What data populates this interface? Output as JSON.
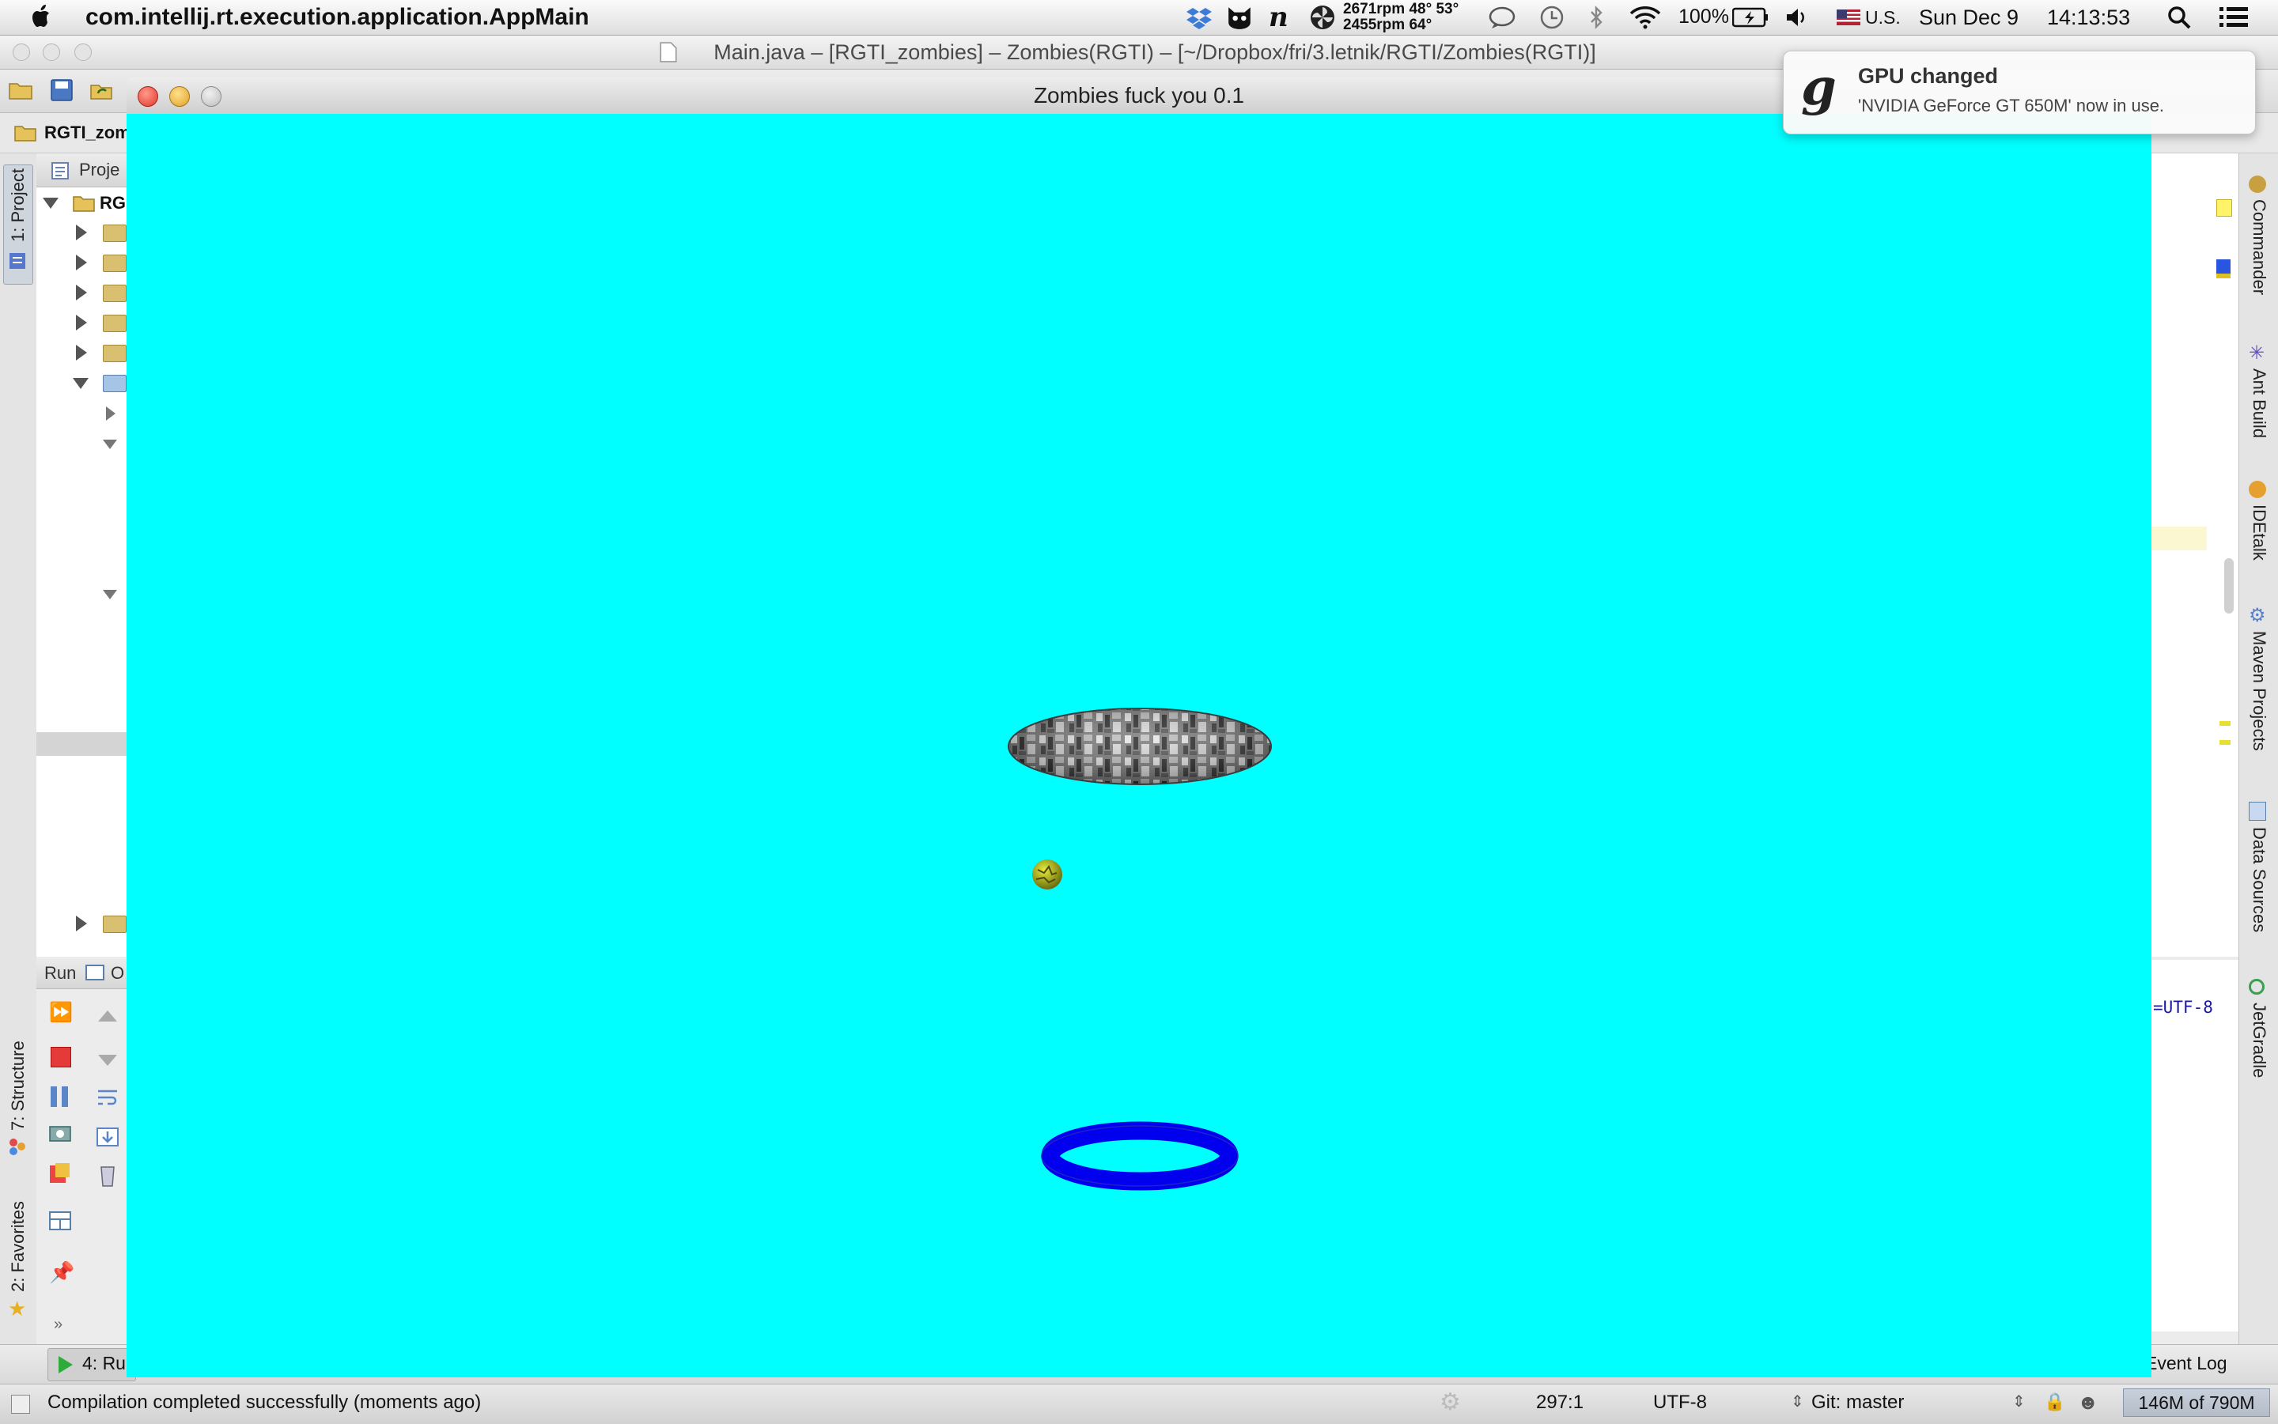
{
  "menubar": {
    "app_name": "com.intellij.rt.execution.application.AppMain",
    "fan_top": "2671rpm 48° 53°",
    "fan_bottom": "2455rpm 64°",
    "battery": "100%",
    "input_source": "U.S.",
    "date": "Sun Dec 9",
    "time": "14:13:53"
  },
  "ide": {
    "window_title": "Main.java – [RGTI_zombies] – Zombies(RGTI) – [~/Dropbox/fri/3.letnik/RGTI/Zombies(RGTI)]",
    "nav_project": "RGTI_zom",
    "project_tab": "Proje",
    "project_root": "RG",
    "left_tabs": {
      "project": "1: Project",
      "structure": "7: Structure",
      "favorites": "2: Favorites"
    },
    "right_tabs": [
      "Commander",
      "Ant Build",
      "IDEtalk",
      "Maven Projects",
      "Data Sources",
      "JetGradle"
    ],
    "run_panel": {
      "label": "Run",
      "tab": "O"
    },
    "editor_fragment": "=UTF-8",
    "bottom_tabs": {
      "run": "4: Ru",
      "event_log": "Event Log"
    },
    "status": {
      "message": "Compilation completed successfully (moments ago)",
      "position": "297:1",
      "encoding": "UTF-8",
      "vcs": "Git: master",
      "memory": "146M of 790M"
    }
  },
  "game": {
    "window_title": "Zombies fuck you 0.1",
    "background_color": "#00ffff",
    "ring_color": "#0000ee"
  },
  "notification": {
    "logo": "g",
    "title": "GPU changed",
    "message": "'NVIDIA GeForce GT 650M' now in use."
  }
}
